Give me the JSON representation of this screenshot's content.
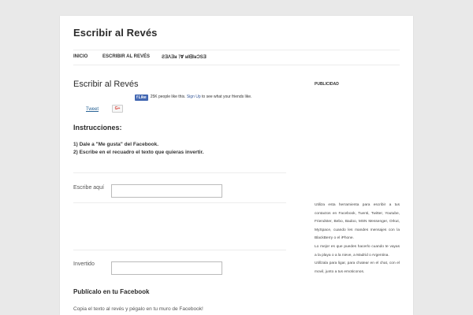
{
  "site": {
    "title": "Escribir al Revés"
  },
  "nav": {
    "items": [
      "INICIO",
      "ESCRIBIR AL REVÉS",
      "ƧƎɅƎᴚ ˥Ɐ ᴚIᗺIᴚƆSƎ"
    ]
  },
  "entry": {
    "title": "Escribir al Revés"
  },
  "social": {
    "like_label": "Like",
    "like_count_text": "25K people like this.",
    "signup_label": "Sign Up",
    "signup_suffix": "to see what your friends like.",
    "tweet_label": "Tweet",
    "gplus_label": "G+"
  },
  "instructions": {
    "heading": "Instrucciones:",
    "step1": "1) Dale a \"Me gusta\" del Facebook.",
    "step2": "2) Escribe en el recuadro el texto que quieras invertir."
  },
  "form": {
    "input_label": "Escribe aquí",
    "input_value": "",
    "output_label": "Invertido",
    "output_value": ""
  },
  "facebook_section": {
    "heading": "Publícalo en tu Facebook",
    "text": "Copia el texto al revés y pégalo en tu muro de Facebook!"
  },
  "sidebar": {
    "widget_title": "PUBLICIDAD",
    "paragraph1": "Utiliza esta herramienta para escribir a tus contactos en Facebook, Tuenti, Twitter, Youtube, Friendster, Bebo, Badoo, MSN Messenger, Orkut, MySpace, cuando les mandes mensajes con la BlackBerry o el iPhone.",
    "paragraph2": "Lo mejor es que puedes hacerlo cuando te vayas a la playa o a la nieve, a Madrid o Argentina.",
    "paragraph3": "Utilízala para ligar, para chatear en el chat, con el movil, junto a tus emoticonos."
  }
}
